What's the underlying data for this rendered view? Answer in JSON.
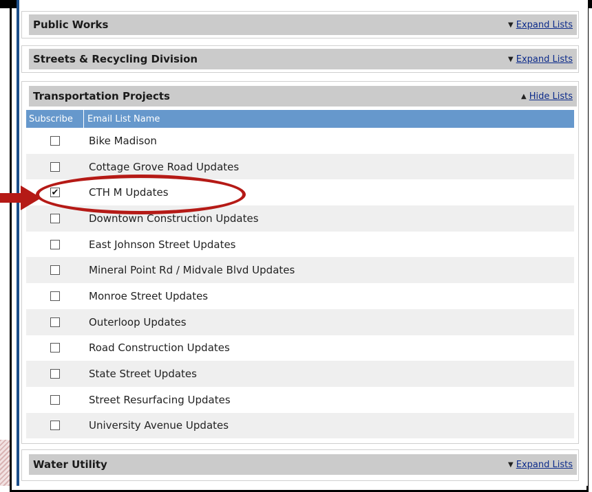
{
  "sections": [
    {
      "title": "Public Works",
      "action_label": "Expand Lists",
      "action_icon": "triangle-down-icon"
    },
    {
      "title": "Streets & Recycling Division",
      "action_label": "Expand Lists",
      "action_icon": "triangle-down-icon"
    },
    {
      "title": "Transportation Projects",
      "action_label": "Hide Lists",
      "action_icon": "triangle-up-icon"
    },
    {
      "title": "Water Utility",
      "action_label": "Expand Lists",
      "action_icon": "triangle-down-icon"
    }
  ],
  "table": {
    "headers": [
      "Subscribe",
      "Email List Name"
    ],
    "rows": [
      {
        "name": "Bike Madison",
        "checked": false
      },
      {
        "name": "Cottage Grove Road Updates",
        "checked": false
      },
      {
        "name": "CTH M Updates",
        "checked": true
      },
      {
        "name": "Downtown Construction Updates",
        "checked": false
      },
      {
        "name": "East Johnson Street Updates",
        "checked": false
      },
      {
        "name": "Mineral Point Rd / Midvale Blvd Updates",
        "checked": false
      },
      {
        "name": "Monroe Street Updates",
        "checked": false
      },
      {
        "name": "Outerloop Updates",
        "checked": false
      },
      {
        "name": "Road Construction Updates",
        "checked": false
      },
      {
        "name": "State Street Updates",
        "checked": false
      },
      {
        "name": "Street Resurfacing Updates",
        "checked": false
      },
      {
        "name": "University Avenue Updates",
        "checked": false
      }
    ]
  },
  "colors": {
    "header_bg": "#cbcbcb",
    "table_header_bg": "#6698cc",
    "link": "#0b2a8a",
    "annotation_red": "#b51a16",
    "panel_border": "#1c4e8a"
  }
}
